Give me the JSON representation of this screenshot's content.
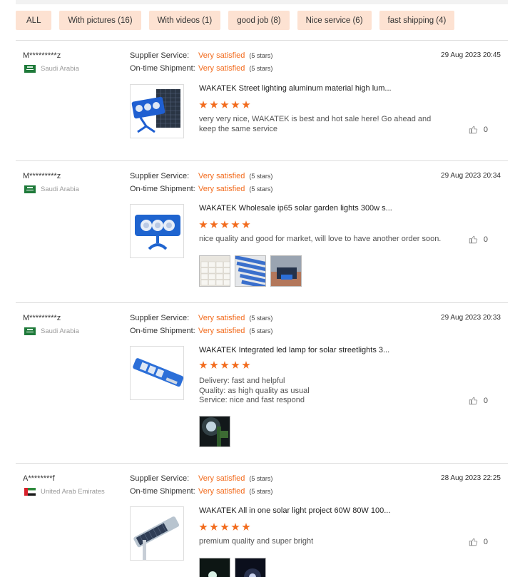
{
  "filters": [
    "ALL",
    "With pictures (16)",
    "With videos (1)",
    "good job (8)",
    "Nice service (6)",
    "fast shipping (4)"
  ],
  "labels": {
    "supplier": "Supplier Service:",
    "shipment": "On-time Shipment:"
  },
  "reviews": [
    {
      "user": "M*********z",
      "country": "Saudi Arabia",
      "flag": "sa",
      "supplier_value": "Very satisfied",
      "supplier_stars": "(5 stars)",
      "shipment_value": "Very satisfied",
      "shipment_stars": "(5 stars)",
      "date": "29 Aug 2023 20:45",
      "product_title": "WAKATEK Street lighting aluminum material high lum...",
      "rating": 5,
      "comment": "very very nice, WAKATEK is best and hot sale here! Go ahead and keep the same service",
      "likes": "0",
      "pics": []
    },
    {
      "user": "M*********z",
      "country": "Saudi Arabia",
      "flag": "sa",
      "supplier_value": "Very satisfied",
      "supplier_stars": "(5 stars)",
      "shipment_value": "Very satisfied",
      "shipment_stars": "(5 stars)",
      "date": "29 Aug 2023 20:34",
      "product_title": "WAKATEK Wholesale ip65 solar garden lights 300w s...",
      "rating": 5,
      "comment": "nice quality and good for market, will love to have another order soon.",
      "likes": "0",
      "pics": [
        "boxes",
        "lamps",
        "panel"
      ]
    },
    {
      "user": "M*********z",
      "country": "Saudi Arabia",
      "flag": "sa",
      "supplier_value": "Very satisfied",
      "supplier_stars": "(5 stars)",
      "shipment_value": "Very satisfied",
      "shipment_stars": "(5 stars)",
      "date": "29 Aug 2023 20:33",
      "product_title": "WAKATEK Integrated led lamp for solar streetlights 3...",
      "rating": 5,
      "comment": "Delivery: fast and helpful\nQuality: as high quality as usual\nService: nice and fast respond",
      "likes": "0",
      "pics": [
        "night"
      ]
    },
    {
      "user": "A********f",
      "country": "United Arab Emirates",
      "flag": "ae",
      "supplier_value": "Very satisfied",
      "supplier_stars": "(5 stars)",
      "shipment_value": "Very satisfied",
      "shipment_stars": "(5 stars)",
      "date": "28 Aug 2023 22:25",
      "product_title": "WAKATEK All in one solar light project 60W 80W 100...",
      "rating": 5,
      "comment": "premium quality and super bright",
      "likes": "0",
      "pics": [
        "night2",
        "night3"
      ]
    }
  ]
}
